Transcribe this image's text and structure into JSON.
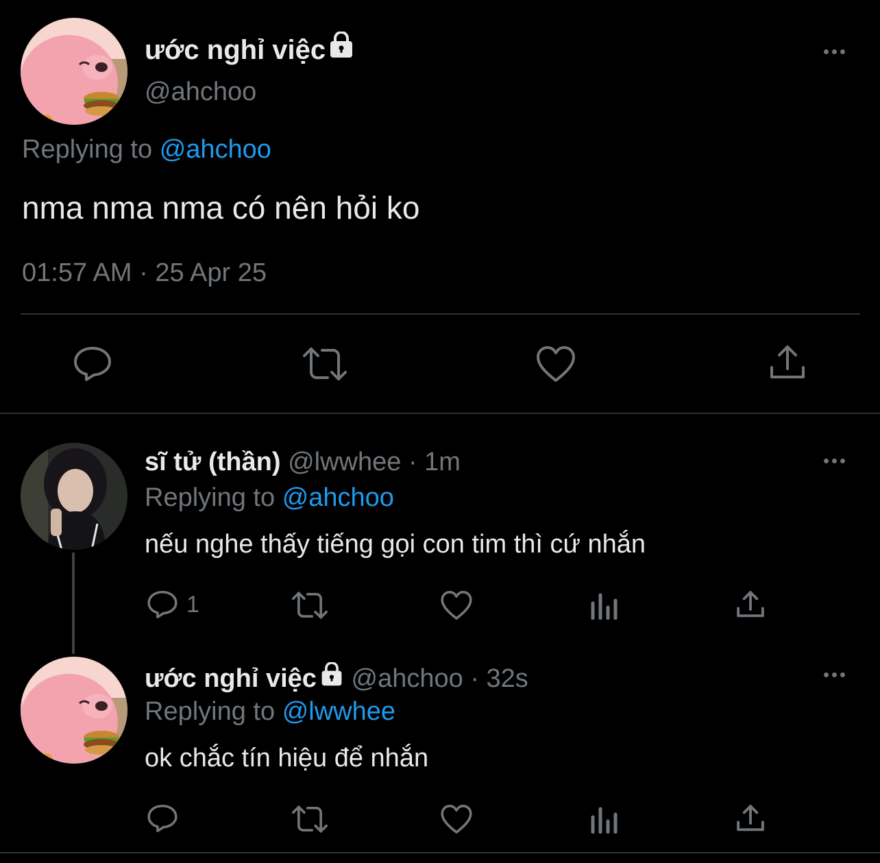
{
  "main_tweet": {
    "display_name": "ước nghỉ việc",
    "lock_icon": "lock-icon",
    "handle": "@ahchoo",
    "replying_prefix": "Replying to",
    "replying_to": "@ahchoo",
    "text": "nma nma nma có nên hỏi ko",
    "timestamp": "01:57 AM · 25 Apr 25",
    "actions": [
      "reply-icon",
      "retweet-icon",
      "like-icon",
      "share-icon"
    ]
  },
  "replies": [
    {
      "display_name": "sĩ tử (thần)",
      "handle": "@lwwhee",
      "separator": "·",
      "time": "1m",
      "replying_prefix": "Replying to",
      "replying_to": "@ahchoo",
      "text": "nếu nghe thấy tiếng gọi con tim thì cứ nhắn",
      "reply_count": "1"
    },
    {
      "display_name": "ước nghỉ việc",
      "handle": "@ahchoo",
      "separator": "·",
      "time": "32s",
      "replying_prefix": "Replying to",
      "replying_to": "@lwwhee",
      "text": "ok chắc tín hiệu để nhắn",
      "reply_count": ""
    }
  ],
  "colors": {
    "background": "#000000",
    "text": "#e7e9ea",
    "muted": "#71767b",
    "link": "#1d9bf0",
    "divider": "#2f3336"
  }
}
